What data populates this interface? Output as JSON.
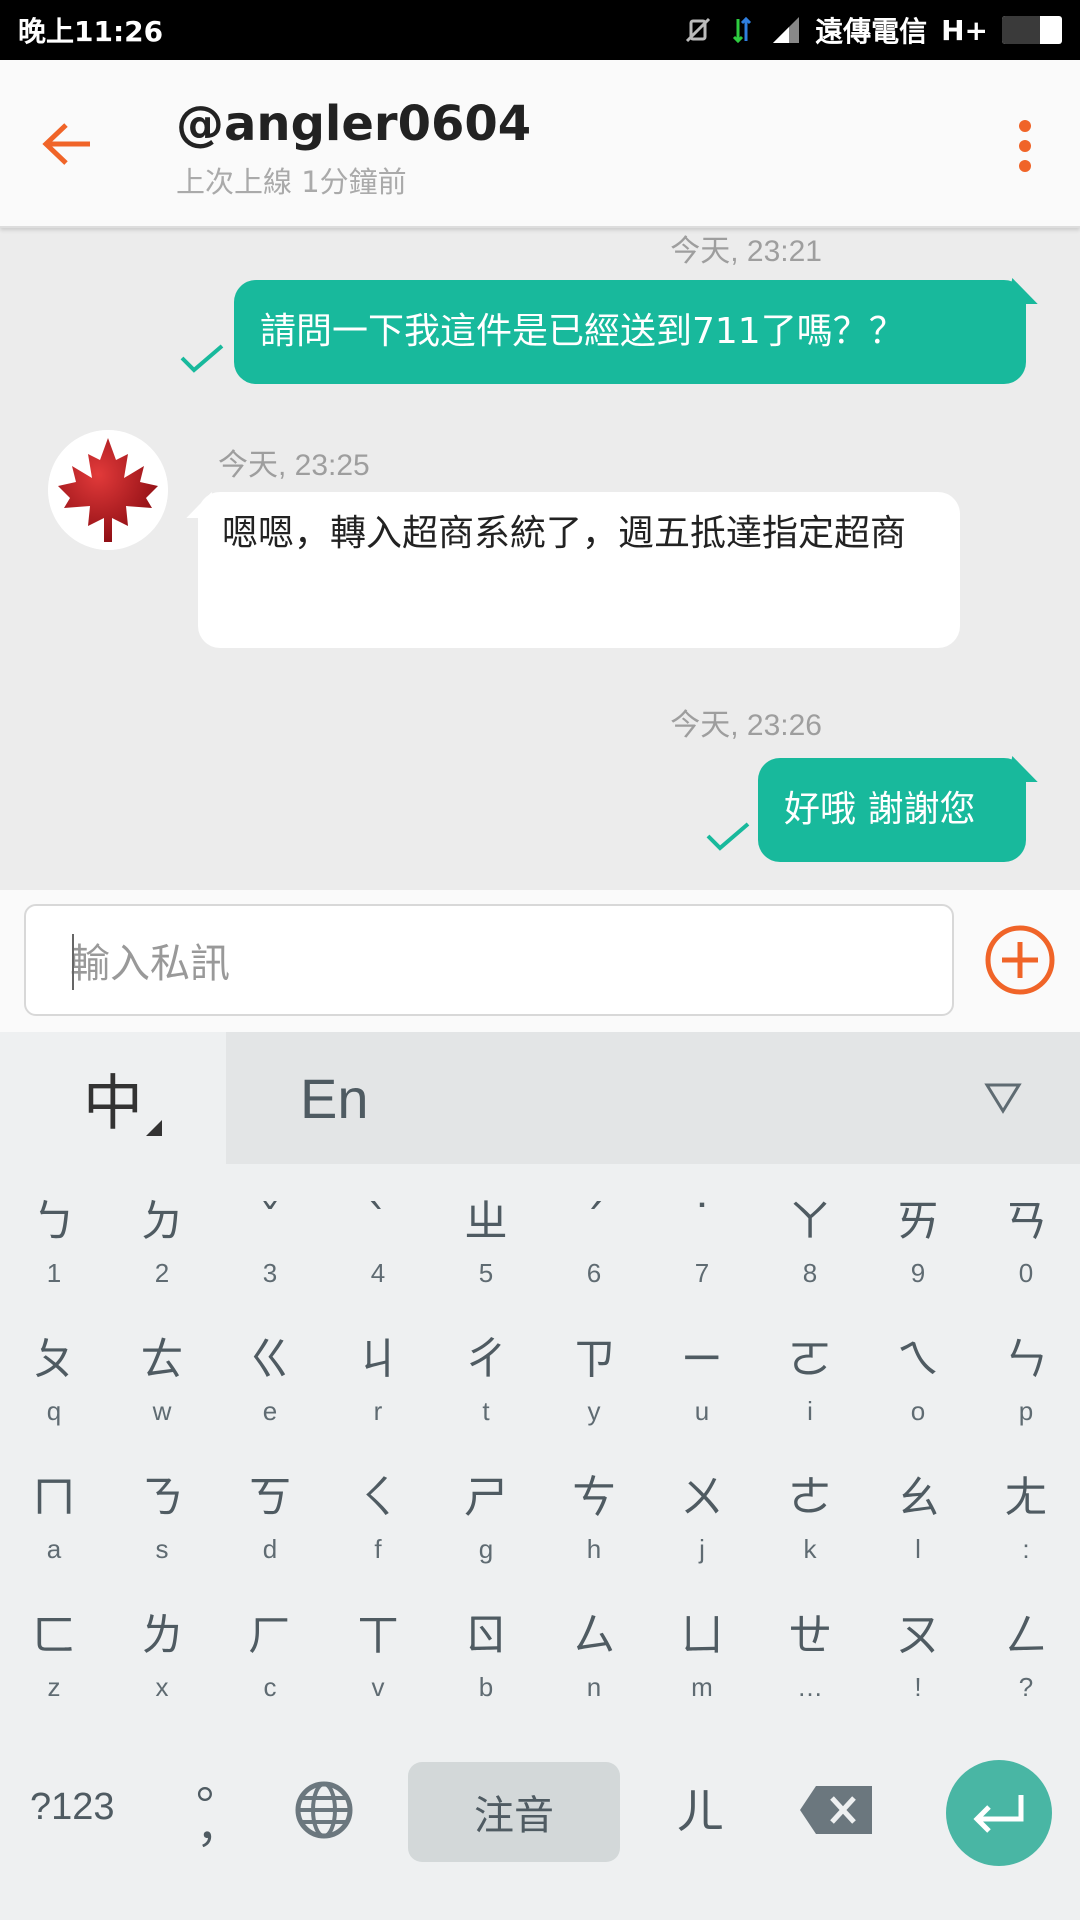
{
  "status_bar": {
    "time": "晚上11:26",
    "carrier": "遠傳電信",
    "network": "H+"
  },
  "header": {
    "title": "@angler0604",
    "subtitle": "上次上線 1分鐘前"
  },
  "messages": [
    {
      "direction": "out",
      "timestamp": "今天, 23:21",
      "text": "請問一下我這件是已經送到711了嗎？？",
      "status": "sent"
    },
    {
      "direction": "in",
      "timestamp": "今天, 23:25",
      "text": "嗯嗯，轉入超商系統了，週五抵達指定超商",
      "avatar": "maple-leaf-avatar"
    },
    {
      "direction": "out",
      "timestamp": "今天, 23:26",
      "text": "好哦 謝謝您",
      "status": "sent"
    }
  ],
  "composer": {
    "placeholder": "輸入私訊"
  },
  "keyboard": {
    "tab_zh": "中",
    "tab_en": "En",
    "rows": [
      [
        {
          "main": "ㄅ",
          "sub": "1"
        },
        {
          "main": "ㄉ",
          "sub": "2"
        },
        {
          "main": "ˇ",
          "sub": "3"
        },
        {
          "main": "ˋ",
          "sub": "4"
        },
        {
          "main": "ㄓ",
          "sub": "5"
        },
        {
          "main": "ˊ",
          "sub": "6"
        },
        {
          "main": "˙",
          "sub": "7"
        },
        {
          "main": "ㄚ",
          "sub": "8"
        },
        {
          "main": "ㄞ",
          "sub": "9"
        },
        {
          "main": "ㄢ",
          "sub": "0"
        }
      ],
      [
        {
          "main": "ㄆ",
          "sub": "q"
        },
        {
          "main": "ㄊ",
          "sub": "w"
        },
        {
          "main": "ㄍ",
          "sub": "e"
        },
        {
          "main": "ㄐ",
          "sub": "r"
        },
        {
          "main": "ㄔ",
          "sub": "t"
        },
        {
          "main": "ㄗ",
          "sub": "y"
        },
        {
          "main": "ㄧ",
          "sub": "u"
        },
        {
          "main": "ㄛ",
          "sub": "i"
        },
        {
          "main": "ㄟ",
          "sub": "o"
        },
        {
          "main": "ㄣ",
          "sub": "p"
        }
      ],
      [
        {
          "main": "ㄇ",
          "sub": "a"
        },
        {
          "main": "ㄋ",
          "sub": "s"
        },
        {
          "main": "ㄎ",
          "sub": "d"
        },
        {
          "main": "ㄑ",
          "sub": "f"
        },
        {
          "main": "ㄕ",
          "sub": "g"
        },
        {
          "main": "ㄘ",
          "sub": "h"
        },
        {
          "main": "ㄨ",
          "sub": "j"
        },
        {
          "main": "ㄜ",
          "sub": "k"
        },
        {
          "main": "ㄠ",
          "sub": "l"
        },
        {
          "main": "ㄤ",
          "sub": ":"
        }
      ],
      [
        {
          "main": "ㄈ",
          "sub": "z"
        },
        {
          "main": "ㄌ",
          "sub": "x"
        },
        {
          "main": "ㄏ",
          "sub": "c"
        },
        {
          "main": "ㄒ",
          "sub": "v"
        },
        {
          "main": "ㄖ",
          "sub": "b"
        },
        {
          "main": "ㄙ",
          "sub": "n"
        },
        {
          "main": "ㄩ",
          "sub": "m"
        },
        {
          "main": "ㄝ",
          "sub": "…"
        },
        {
          "main": "ㄡ",
          "sub": "!"
        },
        {
          "main": "ㄥ",
          "sub": "?"
        }
      ]
    ],
    "symbols_label": "?123",
    "punct_top": "。",
    "punct_bottom": "，",
    "space_label": "注音",
    "er_label": "ㄦ"
  },
  "colors": {
    "accent": "#f06428",
    "outgoing_bubble": "#18b99c",
    "enter_key": "#49b6a4"
  }
}
